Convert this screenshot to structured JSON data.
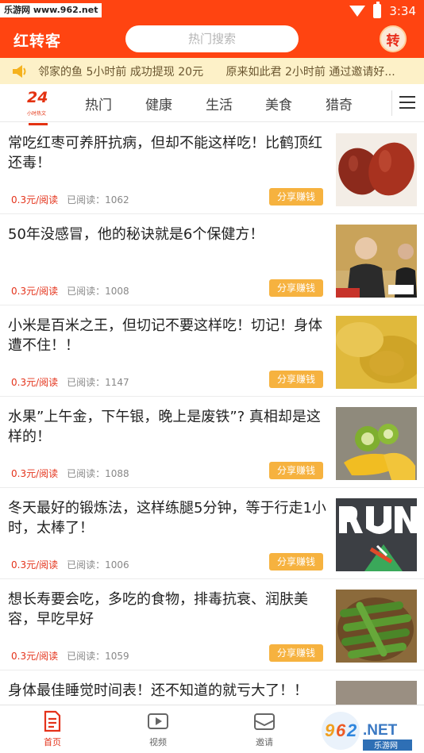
{
  "status_bar": {
    "watermark": "乐游网 www.962.net",
    "time": "3:34"
  },
  "app_bar": {
    "title": "红转客",
    "search_placeholder": "热门搜索",
    "logo_char": "转"
  },
  "notice": {
    "messages": [
      "邻家的鱼 5小时前 成功提现 20元",
      "原来如此君 2小时前 通过邀请好..."
    ]
  },
  "tabs": {
    "logo_number": "24",
    "logo_sub": "小时热文",
    "items": [
      "热门",
      "健康",
      "生活",
      "美食",
      "猎奇"
    ]
  },
  "feed": {
    "share_label": "分享赚钱",
    "items": [
      {
        "title": "常吃红枣可养肝抗病，但却不能这样吃！比鹤顶红还毒！",
        "price": "0.3元/阅读",
        "reads": "已阅读：1062",
        "thumb": "red-dates-image"
      },
      {
        "title": "50年没感冒，他的秘诀就是6个保健方！",
        "price": "0.3元/阅读",
        "reads": "已阅读：1008",
        "thumb": "elderly-man-image"
      },
      {
        "title": "小米是百米之王，但切记不要这样吃！切记！身体遭不住！！",
        "price": "0.3元/阅读",
        "reads": "已阅读：1147",
        "thumb": "millet-image"
      },
      {
        "title": "水果”上午金，下午银，晚上是废铁”? 真相却是这样的！",
        "price": "0.3元/阅读",
        "reads": "已阅读：1088",
        "thumb": "fruit-image"
      },
      {
        "title": "冬天最好的锻炼法，这样练腿5分钟，等于行走1小时，太棒了！",
        "price": "0.3元/阅读",
        "reads": "已阅读：1006",
        "thumb": "run-poster-image"
      },
      {
        "title": "想长寿要会吃，多吃的食物，排毒抗衰、润肤美容，早吃早好",
        "price": "0.3元/阅读",
        "reads": "已阅读：1059",
        "thumb": "okra-image"
      },
      {
        "title": "身体最佳睡觉时间表！还不知道的就亏大了！！",
        "price": "",
        "reads": "",
        "thumb": "bed-image"
      }
    ]
  },
  "bottom_nav": {
    "home": "首页",
    "video": "视频",
    "invite": "邀请"
  },
  "watermark_bottom": {
    "text": "962.NET",
    "sub": "乐游网"
  },
  "colors": {
    "brand": "#ff4411",
    "price": "#e4331b",
    "share": "#f6b23f",
    "notice_bg": "#fdf1c8"
  }
}
